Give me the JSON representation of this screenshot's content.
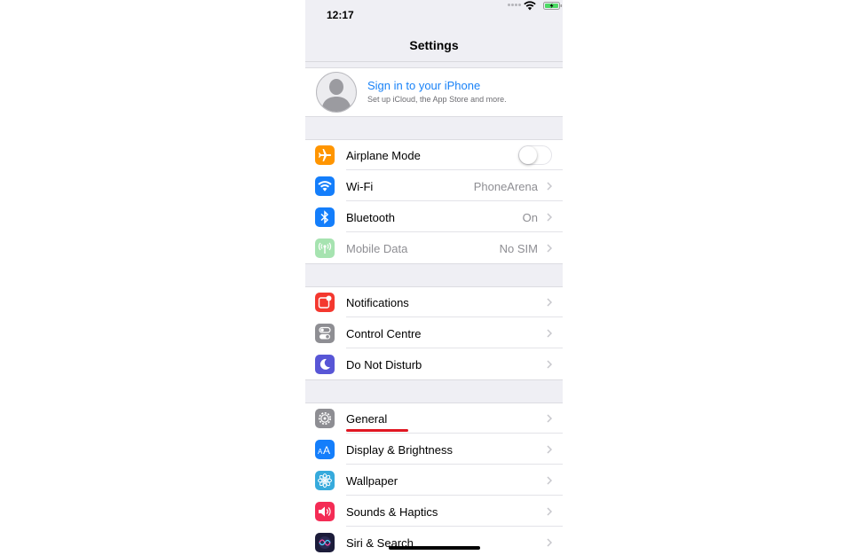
{
  "status": {
    "time": "12:17"
  },
  "nav": {
    "title": "Settings"
  },
  "profile": {
    "title": "Sign in to your iPhone",
    "subtitle": "Set up iCloud, the App Store and more."
  },
  "groups": [
    {
      "rows": [
        {
          "label": "Airplane Mode",
          "icon": "airplane-icon",
          "color": "#ff9500",
          "toggle": false
        },
        {
          "label": "Wi-Fi",
          "icon": "wifi-icon",
          "color": "#147efb",
          "value": "PhoneArena"
        },
        {
          "label": "Bluetooth",
          "icon": "bluetooth-icon",
          "color": "#147efb",
          "value": "On"
        },
        {
          "label": "Mobile Data",
          "icon": "antenna-icon",
          "color": "#a6e3b0",
          "value": "No SIM",
          "disabled": true
        }
      ]
    },
    {
      "rows": [
        {
          "label": "Notifications",
          "icon": "notifications-icon",
          "color": "#f4382f"
        },
        {
          "label": "Control Centre",
          "icon": "switches-icon",
          "color": "#8e8e93"
        },
        {
          "label": "Do Not Disturb",
          "icon": "moon-icon",
          "color": "#5856d6"
        }
      ]
    },
    {
      "rows": [
        {
          "label": "General",
          "icon": "gear-icon",
          "color": "#8e8e93"
        },
        {
          "label": "Display & Brightness",
          "icon": "text-size-icon",
          "color": "#147efb"
        },
        {
          "label": "Wallpaper",
          "icon": "flower-icon",
          "color": "#36aadc"
        },
        {
          "label": "Sounds & Haptics",
          "icon": "speaker-icon",
          "color": "#f42c55"
        },
        {
          "label": "Siri & Search",
          "icon": "siri-icon",
          "color": "#1c1c3a"
        }
      ]
    }
  ],
  "annotation": {
    "color": "#e01722"
  }
}
